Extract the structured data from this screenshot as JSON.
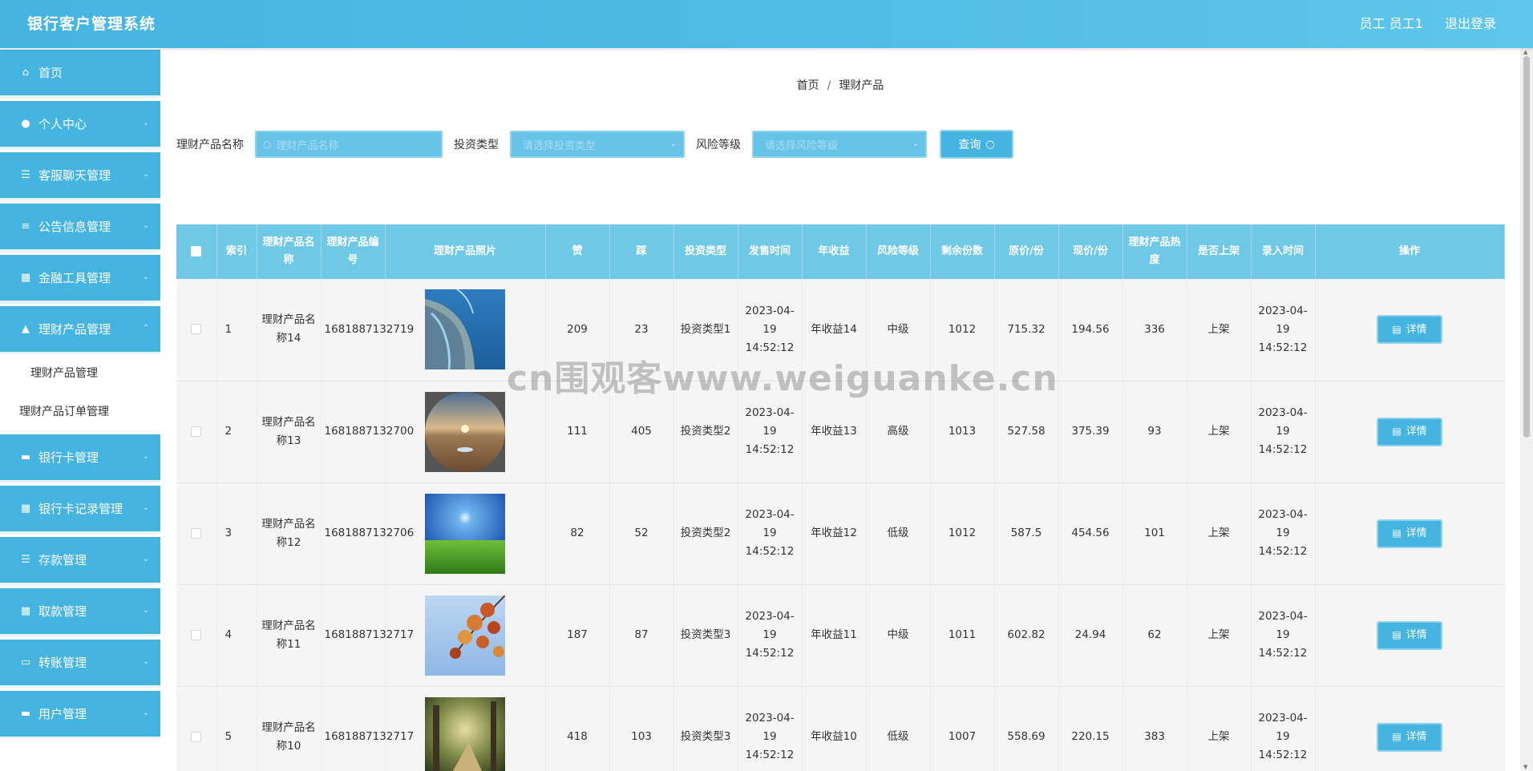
{
  "header": {
    "title": "银行客户管理系统",
    "user_label": "员工 员工1",
    "logout": "退出登录"
  },
  "sidebar": {
    "items": [
      {
        "label": "首页",
        "icon": "home-icon"
      },
      {
        "label": "个人中心",
        "icon": "user-icon"
      },
      {
        "label": "客服聊天管理",
        "icon": "list-icon"
      },
      {
        "label": "公告信息管理",
        "icon": "sliders-icon"
      },
      {
        "label": "金融工具管理",
        "icon": "grid-icon"
      },
      {
        "label": "理财产品管理",
        "icon": "thumb-icon"
      }
    ],
    "subitems": [
      "理财产品管理",
      "理财产品订单管理"
    ],
    "items_after": [
      {
        "label": "银行卡管理",
        "icon": "card-icon"
      },
      {
        "label": "银行卡记录管理",
        "icon": "grid-icon"
      },
      {
        "label": "存款管理",
        "icon": "list-icon"
      },
      {
        "label": "取款管理",
        "icon": "grid-icon"
      },
      {
        "label": "转账管理",
        "icon": "monitor-icon"
      },
      {
        "label": "用户管理",
        "icon": "card-icon"
      }
    ]
  },
  "breadcrumb": {
    "home": "首页",
    "separator": "/",
    "current": "理财产品"
  },
  "filters": {
    "name_label": "理财产品名称",
    "name_placeholder": "理财产品名称",
    "type_label": "投资类型",
    "type_placeholder": "请选择投资类型",
    "risk_label": "风险等级",
    "risk_placeholder": "请选择风险等级",
    "search_button": "查询"
  },
  "table": {
    "columns": [
      "索引",
      "理财产品名称",
      "理财产品编号",
      "理财产品照片",
      "赞",
      "踩",
      "投资类型",
      "发售时间",
      "年收益",
      "风险等级",
      "剩余份数",
      "原价/份",
      "现价/份",
      "理财产品热度",
      "是否上架",
      "录入时间",
      "操作"
    ],
    "detail_label": "详情",
    "rows": [
      {
        "index": "1",
        "name": "理财产品名称14",
        "code": "1681887132719",
        "photo": "coastline-photo",
        "like": "209",
        "dislike": "23",
        "type": "投资类型1",
        "sale_time": "2023-04-19 14:52:12",
        "annual": "年收益14",
        "risk": "中级",
        "remain": "1012",
        "orig_price": "715.32",
        "cur_price": "194.56",
        "heat": "336",
        "listed": "上架",
        "created": "2023-04-19 14:52:12"
      },
      {
        "index": "2",
        "name": "理财产品名称13",
        "code": "1681887132700",
        "photo": "desert-sunset-photo",
        "like": "111",
        "dislike": "405",
        "type": "投资类型2",
        "sale_time": "2023-04-19 14:52:12",
        "annual": "年收益13",
        "risk": "高级",
        "remain": "1013",
        "orig_price": "527.58",
        "cur_price": "375.39",
        "heat": "93",
        "listed": "上架",
        "created": "2023-04-19 14:52:12"
      },
      {
        "index": "3",
        "name": "理财产品名称12",
        "code": "1681887132706",
        "photo": "green-field-photo",
        "like": "82",
        "dislike": "52",
        "type": "投资类型2",
        "sale_time": "2023-04-19 14:52:12",
        "annual": "年收益12",
        "risk": "低级",
        "remain": "1012",
        "orig_price": "587.5",
        "cur_price": "454.56",
        "heat": "101",
        "listed": "上架",
        "created": "2023-04-19 14:52:12"
      },
      {
        "index": "4",
        "name": "理财产品名称11",
        "code": "1681887132717",
        "photo": "autumn-leaves-photo",
        "like": "187",
        "dislike": "87",
        "type": "投资类型3",
        "sale_time": "2023-04-19 14:52:12",
        "annual": "年收益11",
        "risk": "中级",
        "remain": "1011",
        "orig_price": "602.82",
        "cur_price": "24.94",
        "heat": "62",
        "listed": "上架",
        "created": "2023-04-19 14:52:12"
      },
      {
        "index": "5",
        "name": "理财产品名称10",
        "code": "1681887132717",
        "photo": "forest-path-photo",
        "like": "418",
        "dislike": "103",
        "type": "投资类型3",
        "sale_time": "2023-04-19 14:52:12",
        "annual": "年收益10",
        "risk": "低级",
        "remain": "1007",
        "orig_price": "558.69",
        "cur_price": "220.15",
        "heat": "383",
        "listed": "上架",
        "created": "2023-04-19 14:52:12"
      }
    ]
  },
  "watermark": "cn围观客www.weiguanke.cn",
  "colors": {
    "primary": "#45b4e0",
    "header_row": "#6ec8e6",
    "row_bg": "#f5f5f5"
  }
}
